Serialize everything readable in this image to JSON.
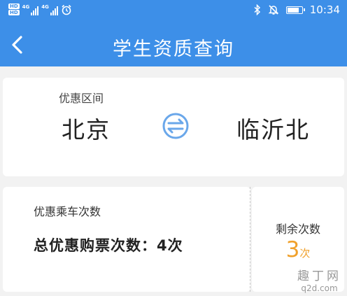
{
  "statusbar": {
    "sim_label_1": "HD",
    "sim_label_2": "HD",
    "network_1": "4G",
    "network_2": "4G",
    "icons": [
      "alarm-icon",
      "bluetooth-icon",
      "mute-icon",
      "battery-icon"
    ],
    "time": "10:34",
    "battery_level": 0.85
  },
  "navbar": {
    "title": "学生资质查询",
    "back_icon": "chevron-left-icon"
  },
  "route": {
    "label": "优惠区间",
    "from": "北京",
    "to": "临沂北",
    "swap_icon": "swap-arrows-icon"
  },
  "rides": {
    "label": "优惠乘车次数",
    "total_text": "总优惠购票次数：4次",
    "remaining_label": "剩余次数",
    "remaining_value": "3",
    "remaining_unit": "次"
  },
  "watermark": {
    "line1": "趣丁网",
    "line2": "q2d.com"
  },
  "colors": {
    "primary": "#3d8fe8",
    "accent": "#f0a12c",
    "background": "#f2f2f2",
    "card": "#ffffff"
  }
}
